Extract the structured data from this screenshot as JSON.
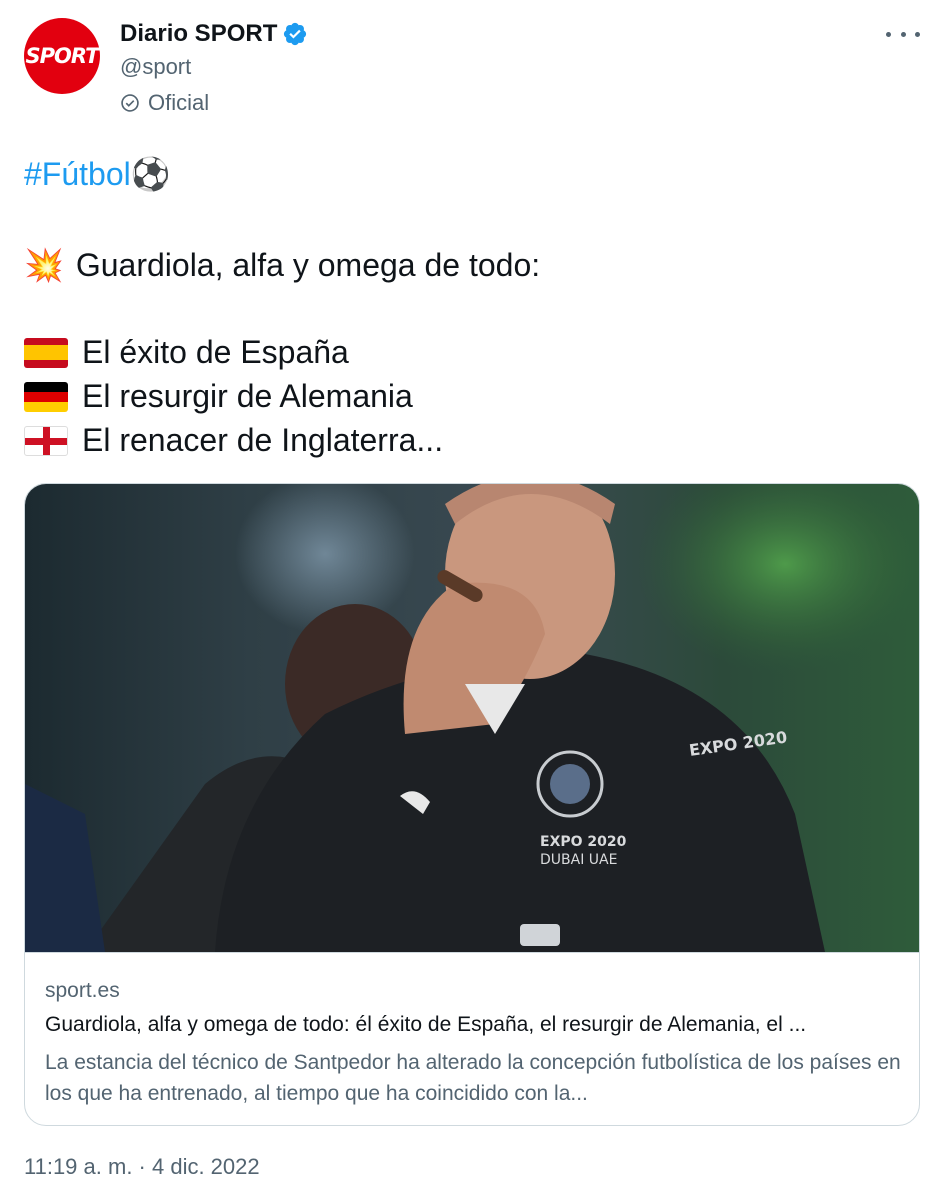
{
  "author": {
    "name": "Diario SPORT",
    "handle": "@sport",
    "label": "Oficial",
    "avatar_text": "SPORT",
    "brand_color": "#e2000f",
    "verified_color": "#1d9bf0"
  },
  "tweet": {
    "hashtag": "#Fútbol",
    "hashtag_emoji": "⚽",
    "headline_emoji": "💥",
    "headline": "Guardiola, alfa y omega de todo:",
    "lines": [
      {
        "flag": "spain-flag",
        "text": "El éxito de España"
      },
      {
        "flag": "germany-flag",
        "text": "El resurgir de Alemania"
      },
      {
        "flag": "england-flag",
        "text": "El renacer de Inglaterra..."
      }
    ],
    "timestamp": "11:19 a. m. · 4 dic. 2022"
  },
  "card": {
    "domain": "sport.es",
    "title": "Guardiola, alfa y omega de todo: él éxito de España, el resurgir de Alemania, el ...",
    "description": "La estancia del técnico de Santpedor ha alterado la concepción futbolística de los países en los que ha entrenado, al tiempo que ha coincidido con la...",
    "image_text_1": "EXPO 2020",
    "image_text_2": "DUBAI UAE"
  }
}
